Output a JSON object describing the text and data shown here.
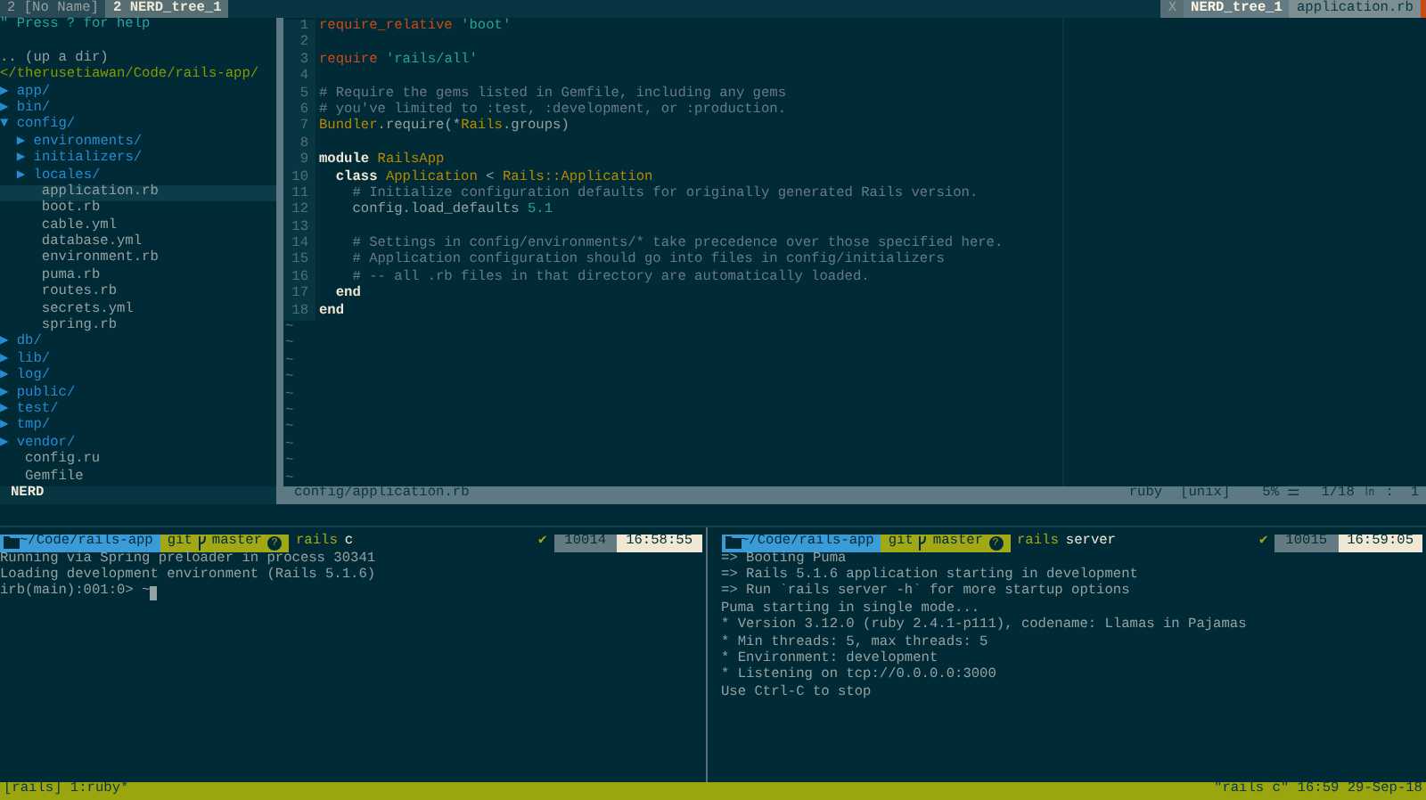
{
  "tabline": {
    "tabs": [
      {
        "label": "2 [No Name]",
        "selected": false
      },
      {
        "label": "2 NERD_tree_1",
        "selected": true
      }
    ],
    "right": [
      {
        "label": "X",
        "kind": "close"
      },
      {
        "label": "NERD_tree_1",
        "kind": "buffer"
      },
      {
        "label": "application.rb",
        "kind": "file"
      }
    ]
  },
  "tree": {
    "help": "\" Press ? for help",
    "up": ".. (up a dir)",
    "root": "</therusetiawan/Code/rails-app/",
    "items": [
      {
        "arrow": "▶",
        "name": "app/",
        "kind": "dir",
        "selected": false
      },
      {
        "arrow": "▶",
        "name": "bin/",
        "kind": "dir",
        "selected": false
      },
      {
        "arrow": "▼",
        "name": "config/",
        "kind": "dir",
        "selected": false,
        "children": [
          {
            "arrow": "▶",
            "name": "environments/",
            "kind": "dir",
            "selected": false
          },
          {
            "arrow": "▶",
            "name": "initializers/",
            "kind": "dir",
            "selected": false
          },
          {
            "arrow": "▶",
            "name": "locales/",
            "kind": "dir",
            "selected": false
          },
          {
            "name": "application.rb",
            "kind": "file",
            "selected": true
          },
          {
            "name": "boot.rb",
            "kind": "file",
            "selected": false
          },
          {
            "name": "cable.yml",
            "kind": "file",
            "selected": false
          },
          {
            "name": "database.yml",
            "kind": "file",
            "selected": false
          },
          {
            "name": "environment.rb",
            "kind": "file",
            "selected": false
          },
          {
            "name": "puma.rb",
            "kind": "file",
            "selected": false
          },
          {
            "name": "routes.rb",
            "kind": "file",
            "selected": false
          },
          {
            "name": "secrets.yml",
            "kind": "file",
            "selected": false
          },
          {
            "name": "spring.rb",
            "kind": "file",
            "selected": false
          }
        ]
      },
      {
        "arrow": "▶",
        "name": "db/",
        "kind": "dir",
        "selected": false
      },
      {
        "arrow": "▶",
        "name": "lib/",
        "kind": "dir",
        "selected": false
      },
      {
        "arrow": "▶",
        "name": "log/",
        "kind": "dir",
        "selected": false
      },
      {
        "arrow": "▶",
        "name": "public/",
        "kind": "dir",
        "selected": false
      },
      {
        "arrow": "▶",
        "name": "test/",
        "kind": "dir",
        "selected": false
      },
      {
        "arrow": "▶",
        "name": "tmp/",
        "kind": "dir",
        "selected": false
      },
      {
        "arrow": "▶",
        "name": "vendor/",
        "kind": "dir",
        "selected": false
      },
      {
        "name": "config.ru",
        "kind": "file",
        "selected": false
      },
      {
        "name": "Gemfile",
        "kind": "file",
        "selected": false
      }
    ]
  },
  "editor": {
    "lines": [
      {
        "number": "1",
        "tokens": [
          {
            "kind": "keyword",
            "text": "require_relative"
          },
          {
            "kind": "string",
            "text": " 'boot'"
          }
        ]
      },
      {
        "number": "2"
      },
      {
        "number": "3",
        "tokens": [
          {
            "kind": "keyword",
            "text": "require"
          },
          {
            "kind": "string",
            "text": " 'rails/all'"
          }
        ]
      },
      {
        "number": "4"
      },
      {
        "number": "5",
        "tokens": [
          {
            "kind": "comment",
            "text": "# Require the gems listed in Gemfile, including any gems"
          }
        ]
      },
      {
        "number": "6",
        "tokens": [
          {
            "kind": "comment",
            "text": "# you've limited to :test, :development, or :production."
          }
        ]
      },
      {
        "number": "7",
        "tokens": [
          {
            "kind": "constant",
            "text": "Bundler"
          },
          {
            "kind": "plain",
            "text": ".require(*"
          },
          {
            "kind": "constant",
            "text": "Rails"
          },
          {
            "kind": "plain",
            "text": ".groups)"
          }
        ]
      },
      {
        "number": "8"
      },
      {
        "number": "9",
        "tokens": [
          {
            "kind": "bold",
            "text": "module "
          },
          {
            "kind": "constant",
            "text": "RailsApp"
          }
        ]
      },
      {
        "number": "10",
        "tokens": [
          {
            "kind": "bold",
            "text": "  class "
          },
          {
            "kind": "constant",
            "text": "Application"
          },
          {
            "kind": "plain",
            "text": " < "
          },
          {
            "kind": "constant",
            "text": "Rails::Application"
          }
        ]
      },
      {
        "number": "11",
        "tokens": [
          {
            "kind": "comment",
            "text": "    # Initialize configuration defaults for originally generated Rails version."
          }
        ]
      },
      {
        "number": "12",
        "tokens": [
          {
            "kind": "plain",
            "text": "    config.load_defaults "
          },
          {
            "kind": "number",
            "text": "5.1"
          }
        ]
      },
      {
        "number": "13"
      },
      {
        "number": "14",
        "tokens": [
          {
            "kind": "comment",
            "text": "    # Settings in config/environments/* take precedence over those specified here."
          }
        ]
      },
      {
        "number": "15",
        "tokens": [
          {
            "kind": "comment",
            "text": "    # Application configuration should go into files in config/initializers"
          }
        ]
      },
      {
        "number": "16",
        "tokens": [
          {
            "kind": "comment",
            "text": "    # -- all .rb files in that directory are automatically loaded."
          }
        ]
      },
      {
        "number": "17",
        "tokens": [
          {
            "kind": "bold",
            "text": "  end"
          }
        ]
      },
      {
        "number": "18",
        "tokens": [
          {
            "kind": "bold",
            "text": "end"
          }
        ]
      }
    ],
    "fillers": [
      "~",
      "~",
      "~",
      "~",
      "~",
      "~",
      "~",
      "~",
      "~",
      "~"
    ]
  },
  "statusline": {
    "mode": "NERD",
    "file": "config/application.rb",
    "filetype": "ruby",
    "format": "[unix]",
    "percent": "5% ☰",
    "position": "1/18 ㏑ :  1"
  },
  "panes": [
    {
      "path": "~/Code/rails-app",
      "vcs": "git",
      "branch": "master",
      "dirty": "?",
      "command_name": "rails",
      "command_args": "c",
      "ok": "✔",
      "history": "10014",
      "time": "16:58:55",
      "output": [
        "Running via Spring preloader in process 30341",
        "Loading development environment (Rails 5.1.6)"
      ],
      "prompt": "irb(main):001:0> ~"
    },
    {
      "path": "~/Code/rails-app",
      "vcs": "git",
      "branch": "master",
      "dirty": "?",
      "command_name": "rails",
      "command_args": "server",
      "ok": "✔",
      "history": "10015",
      "time": "16:59:05",
      "output": [
        "=> Booting Puma",
        "=> Rails 5.1.6 application starting in development",
        "=> Run `rails server -h` for more startup options",
        "Puma starting in single mode...",
        "* Version 3.12.0 (ruby 2.4.1-p111), codename: Llamas in Pajamas",
        "* Min threads: 5, max threads: 5",
        "* Environment: development",
        "* Listening on tcp://0.0.0.0:3000",
        "Use Ctrl-C to stop"
      ]
    }
  ],
  "tmux": {
    "session": "[rails] 1:ruby*",
    "right": "\"rails c\" 16:59 29-Sep-18"
  }
}
